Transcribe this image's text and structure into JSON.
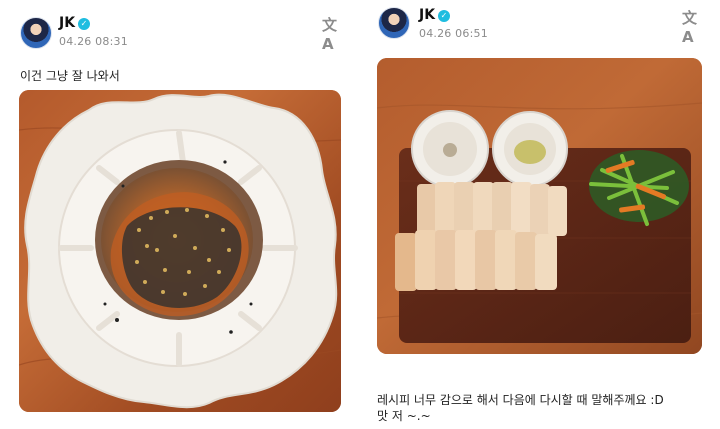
{
  "posts": [
    {
      "author": "JK",
      "timestamp": "04.26 08:31",
      "caption": "이건 그냥 잘 나와서",
      "translate_icon": "translate-icon",
      "verified_icon": "verified-badge-icon"
    },
    {
      "author": "JK",
      "timestamp": "04.26 06:51",
      "caption": "레시피 너무 감으로 해서 다음에 다시할 때 말해주께요 :D\n맛 저 ~.~",
      "translate_icon": "translate-icon",
      "verified_icon": "verified-badge-icon"
    }
  ],
  "icons": {
    "translate": "文A",
    "check": "✓"
  },
  "colors": {
    "verified": "#1fbde0",
    "wood": "#b75d2d",
    "plate": "#f0ede7"
  }
}
